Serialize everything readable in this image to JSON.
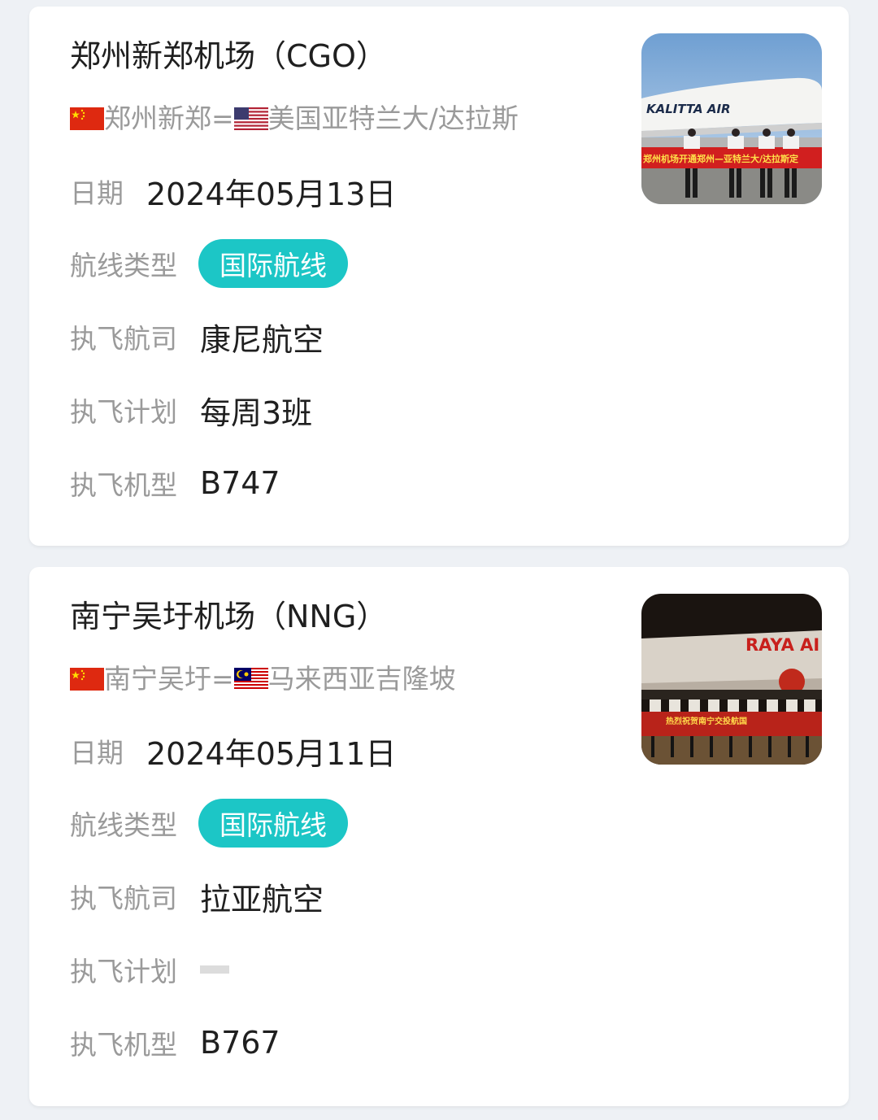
{
  "labels": {
    "date": "日期",
    "route_type": "航线类型",
    "airline": "执飞航司",
    "schedule": "执飞计划",
    "aircraft": "执飞机型"
  },
  "colors": {
    "badge": "#1cc6c6",
    "label": "#9a9a9a",
    "text": "#1f1f1f"
  },
  "cards": [
    {
      "title": "郑州新郑机场（CGO）",
      "origin_flag": "china-flag-icon",
      "origin": "郑州新郑=",
      "dest_flag": "usa-flag-icon",
      "destination": "美国亚特兰大/达拉斯",
      "date": "2024年05月13日",
      "route_type": "国际航线",
      "airline": "康尼航空",
      "schedule": "每周3班",
      "aircraft": "B747",
      "photo": {
        "airline_text": "KALITTA AIR",
        "banner_text": "郑州机场开通郑州—亚特兰大/达拉斯定"
      }
    },
    {
      "title": "南宁吴圩机场（NNG）",
      "origin_flag": "china-flag-icon",
      "origin": "南宁吴圩=",
      "dest_flag": "malaysia-flag-icon",
      "destination": "马来西亚吉隆坡",
      "date": "2024年05月11日",
      "route_type": "国际航线",
      "airline": "拉亚航空",
      "schedule": "",
      "aircraft": "B767",
      "photo": {
        "airline_text": "RAYA AI",
        "banner_text": "热烈祝贺南宁交投航国"
      }
    }
  ]
}
